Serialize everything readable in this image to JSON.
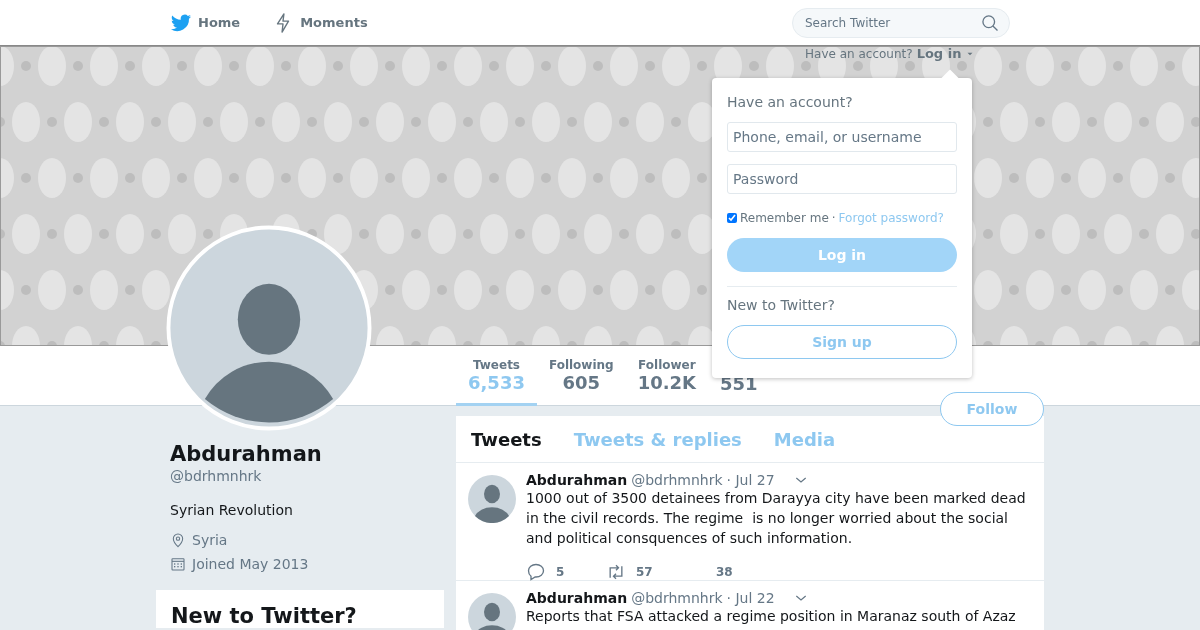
{
  "nav": {
    "items": [
      {
        "kind": "home",
        "label": "Home"
      },
      {
        "kind": "moments",
        "label": "Moments"
      }
    ],
    "search": {
      "placeholder": "Search Twitter"
    }
  },
  "account_prompt": {
    "text": "Have an account?",
    "link": "Log in"
  },
  "login_popup": {
    "title": "Have an account?",
    "username": {
      "placeholder": "Phone, email, or username"
    },
    "password": {
      "placeholder": "Password"
    },
    "remember": {
      "label": "Remember me",
      "checked": true
    },
    "separator": "·",
    "forgot": "Forgot password?",
    "login_button": {
      "label": "Log in",
      "disabled": true
    },
    "signup_title": "New to Twitter?",
    "signup_button": "Sign up"
  },
  "stats": [
    {
      "label": "Tweets",
      "value": "6,533",
      "selected": true
    },
    {
      "label": "Following",
      "value": "605",
      "selected": false
    },
    {
      "label": "Follower",
      "value": "10.2K",
      "selected": false
    },
    {
      "value": "551",
      "selected": false
    }
  ],
  "follow_button": "Follow",
  "profile": {
    "name": "Abdurahman",
    "handle": "@bdrhmnhrk",
    "bio": "Syrian Revolution",
    "location": "Syria",
    "joined": "Joined May 2013"
  },
  "signup_card": {
    "title": "New to Twitter?"
  },
  "timeline_tabs": [
    {
      "label": "Tweets",
      "selected": true
    },
    {
      "label": "Tweets & replies",
      "selected": false
    },
    {
      "label": "Media",
      "selected": false
    }
  ],
  "tweets": [
    {
      "name": "Abdurahman",
      "handle": "@bdrhmnhrk",
      "date": "· Jul 27",
      "text": "1000 out of 3500 detainees from Darayya city have been marked dead in the civil records. The regime  is no longer worried about the social and political consquences of such information.",
      "replies": "5",
      "retweets": "57",
      "likes": "38"
    },
    {
      "name": "Abdurahman",
      "handle": "@bdrhmnhrk",
      "date": "· Jul 22",
      "text": "Reports that FSA attacked a regime position in Maranaz south of Azaz"
    }
  ]
}
